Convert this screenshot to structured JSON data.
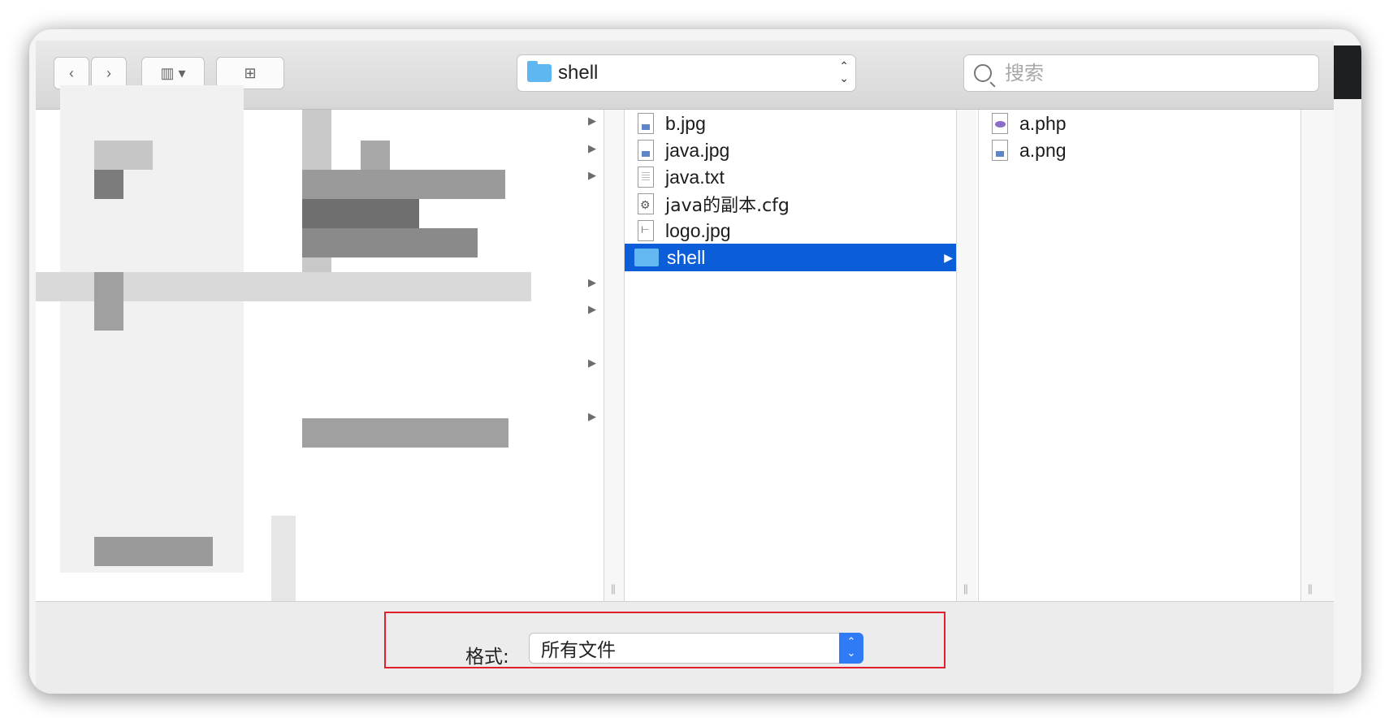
{
  "toolbar": {
    "back_icon": "chevron-left-icon",
    "forward_icon": "chevron-right-icon",
    "view_icon": "column-view-icon",
    "new_folder_icon": "new-folder-icon",
    "location": "shell",
    "search_placeholder": "搜索"
  },
  "column2": {
    "items": [
      {
        "name": "b.jpg",
        "icon": "image-file-icon"
      },
      {
        "name": "java.jpg",
        "icon": "image-file-icon"
      },
      {
        "name": "java.txt",
        "icon": "text-file-icon"
      },
      {
        "name": "java的副本.cfg",
        "icon": "config-file-icon"
      },
      {
        "name": "logo.jpg",
        "icon": "image-file-icon"
      },
      {
        "name": "shell",
        "icon": "folder-icon",
        "selected": true
      }
    ]
  },
  "column3": {
    "items": [
      {
        "name": "a.php",
        "icon": "php-file-icon"
      },
      {
        "name": "a.png",
        "icon": "image-file-icon"
      }
    ]
  },
  "format": {
    "label": "格式:",
    "selected": "所有文件"
  },
  "colors": {
    "selection": "#0b5ed7",
    "highlight_box": "#e0202a",
    "select_stepper": "#2f7bf5"
  }
}
